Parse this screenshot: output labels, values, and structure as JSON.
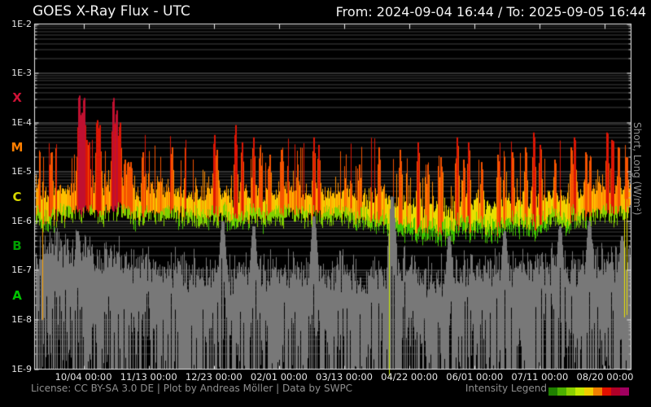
{
  "header": {
    "title": "GOES X-Ray Flux - UTC",
    "range": "From: 2024-09-04 16:44  /  To: 2025-09-05 16:44"
  },
  "footer": {
    "license": "License: CC BY-SA 3.0 DE | Plot by Andreas Möller | Data by SWPC",
    "legend_label": "Intensity Legend"
  },
  "right_axis_label": "Short, Long (W/m²)",
  "chart_data": {
    "type": "line",
    "title": "GOES X-Ray Flux - UTC",
    "x_range": {
      "from": "2024-09-04 16:44",
      "to": "2025-09-05 16:44",
      "days": 366
    },
    "ylog_range": [
      -9,
      -2
    ],
    "grid": "log-minor-horizontal",
    "y_ticks": [
      {
        "label": "1E-2",
        "log": -2
      },
      {
        "label": "1E-3",
        "log": -3
      },
      {
        "label": "1E-4",
        "log": -4
      },
      {
        "label": "1E-5",
        "log": -5
      },
      {
        "label": "1E-6",
        "log": -6
      },
      {
        "label": "1E-7",
        "log": -7
      },
      {
        "label": "1E-8",
        "log": -8
      },
      {
        "label": "1E-9",
        "log": -9
      }
    ],
    "class_bands": [
      {
        "label": "X",
        "color": "#cf1236",
        "log_mid": -3.5
      },
      {
        "label": "M",
        "color": "#ff7f00",
        "log_mid": -4.5
      },
      {
        "label": "C",
        "color": "#d8d800",
        "log_mid": -5.5
      },
      {
        "label": "B",
        "color": "#00a000",
        "log_mid": -6.5
      },
      {
        "label": "A",
        "color": "#00c400",
        "log_mid": -7.5
      }
    ],
    "x_ticks": [
      {
        "label": "10/04 00:00",
        "day": 30
      },
      {
        "label": "11/13 00:00",
        "day": 70
      },
      {
        "label": "12/23 00:00",
        "day": 110
      },
      {
        "label": "02/01 00:00",
        "day": 150
      },
      {
        "label": "03/13 00:00",
        "day": 190
      },
      {
        "label": "04/22 00:00",
        "day": 230
      },
      {
        "label": "06/01 00:00",
        "day": 270
      },
      {
        "label": "07/11 00:00",
        "day": 310
      },
      {
        "label": "08/20 00:00",
        "day": 350
      }
    ],
    "series": [
      {
        "name": "long",
        "color_mode": "intensity",
        "baseline_keyframes_log10": [
          [
            0,
            -5.75
          ],
          [
            8,
            -5.85
          ],
          [
            15,
            -5.7
          ],
          [
            25,
            -5.6
          ],
          [
            32,
            -5.55
          ],
          [
            40,
            -5.65
          ],
          [
            48,
            -5.55
          ],
          [
            56,
            -5.65
          ],
          [
            62,
            -5.8
          ],
          [
            70,
            -5.65
          ],
          [
            78,
            -5.75
          ],
          [
            85,
            -5.65
          ],
          [
            95,
            -5.75
          ],
          [
            105,
            -5.8
          ],
          [
            112,
            -5.7
          ],
          [
            120,
            -5.85
          ],
          [
            128,
            -5.75
          ],
          [
            135,
            -5.7
          ],
          [
            142,
            -5.8
          ],
          [
            150,
            -5.75
          ],
          [
            158,
            -5.65
          ],
          [
            165,
            -5.75
          ],
          [
            172,
            -5.7
          ],
          [
            180,
            -5.78
          ],
          [
            188,
            -5.7
          ],
          [
            196,
            -5.8
          ],
          [
            204,
            -5.88
          ],
          [
            212,
            -5.82
          ],
          [
            220,
            -5.95
          ],
          [
            228,
            -6.02
          ],
          [
            235,
            -6.1
          ],
          [
            242,
            -6.05
          ],
          [
            250,
            -6.12
          ],
          [
            258,
            -6.05
          ],
          [
            265,
            -5.95
          ],
          [
            272,
            -6.0
          ],
          [
            280,
            -6.05
          ],
          [
            288,
            -5.95
          ],
          [
            296,
            -5.9
          ],
          [
            304,
            -5.95
          ],
          [
            312,
            -5.85
          ],
          [
            318,
            -5.75
          ],
          [
            325,
            -5.85
          ],
          [
            332,
            -5.8
          ],
          [
            340,
            -5.7
          ],
          [
            348,
            -5.65
          ],
          [
            355,
            -5.72
          ],
          [
            360,
            -5.65
          ],
          [
            366,
            -5.6
          ]
        ],
        "flares_log10_peaks": [
          [
            10,
            -4.6
          ],
          [
            27,
            -3.45
          ],
          [
            28.5,
            -3.8
          ],
          [
            30,
            -3.5
          ],
          [
            31.5,
            -4.35
          ],
          [
            33,
            -4.4
          ],
          [
            38,
            -3.95
          ],
          [
            39.5,
            -4.05
          ],
          [
            48,
            -3.5
          ],
          [
            50,
            -3.75
          ],
          [
            52,
            -4.0
          ],
          [
            55,
            -4.75
          ],
          [
            57,
            -4.8
          ],
          [
            58.5,
            -4.8
          ],
          [
            66,
            -4.6
          ],
          [
            84,
            -4.5
          ],
          [
            110,
            -4.25
          ],
          [
            111.5,
            -4.55
          ],
          [
            123,
            -4.05
          ],
          [
            127,
            -4.4
          ],
          [
            134,
            -4.3
          ],
          [
            138,
            -4.5
          ],
          [
            144,
            -4.65
          ],
          [
            151,
            -4.55
          ],
          [
            161,
            -4.85
          ],
          [
            171,
            -4.3
          ],
          [
            174,
            -4.45
          ],
          [
            199,
            -4.85
          ],
          [
            211,
            -4.5
          ],
          [
            224,
            -4.55
          ],
          [
            235,
            -4.4
          ],
          [
            241,
            -4.85
          ],
          [
            249,
            -4.7
          ],
          [
            259,
            -4.3
          ],
          [
            263,
            -4.75
          ],
          [
            266,
            -4.4
          ],
          [
            274,
            -4.8
          ],
          [
            284,
            -4.65
          ],
          [
            293,
            -4.6
          ],
          [
            301,
            -4.5
          ],
          [
            306,
            -4.2
          ],
          [
            310,
            -4.45
          ],
          [
            319,
            -4.75
          ],
          [
            329,
            -4.5
          ],
          [
            331,
            -4.3
          ],
          [
            338,
            -4.6
          ],
          [
            351,
            -4.2
          ],
          [
            354,
            -4.35
          ],
          [
            358,
            -4.5
          ],
          [
            363,
            -4.7
          ]
        ]
      },
      {
        "name": "short",
        "color": "#787878",
        "envelope_keyframes_log10": [
          [
            0,
            -6.6
          ],
          [
            10,
            -6.5
          ],
          [
            20,
            -6.7
          ],
          [
            30,
            -6.55
          ],
          [
            40,
            -6.7
          ],
          [
            50,
            -6.6
          ],
          [
            60,
            -6.9
          ],
          [
            70,
            -6.8
          ],
          [
            80,
            -7.0
          ],
          [
            90,
            -6.9
          ],
          [
            100,
            -7.05
          ],
          [
            110,
            -6.95
          ],
          [
            120,
            -7.1
          ],
          [
            130,
            -7.0
          ],
          [
            140,
            -6.95
          ],
          [
            150,
            -7.05
          ],
          [
            160,
            -6.95
          ],
          [
            170,
            -7.0
          ],
          [
            180,
            -7.05
          ],
          [
            190,
            -7.0
          ],
          [
            200,
            -7.1
          ],
          [
            210,
            -7.0
          ],
          [
            220,
            -6.9
          ],
          [
            228,
            -6.75
          ],
          [
            235,
            -7.0
          ],
          [
            245,
            -7.1
          ],
          [
            255,
            -7.05
          ],
          [
            265,
            -7.0
          ],
          [
            275,
            -7.05
          ],
          [
            285,
            -6.95
          ],
          [
            295,
            -7.0
          ],
          [
            305,
            -6.9
          ],
          [
            315,
            -6.85
          ],
          [
            325,
            -6.95
          ],
          [
            335,
            -6.9
          ],
          [
            345,
            -6.8
          ],
          [
            355,
            -6.85
          ],
          [
            366,
            -6.8
          ]
        ],
        "envelope_peaks_log10": [
          [
            26,
            -6.2
          ],
          [
            115,
            -6.0
          ],
          [
            134,
            -6.1
          ],
          [
            171,
            -5.9
          ],
          [
            219,
            -5.5
          ],
          [
            254,
            -6.3
          ],
          [
            288,
            -6.2
          ],
          [
            322,
            -6.1
          ],
          [
            340,
            -6.0
          ],
          [
            360,
            -6.3
          ]
        ]
      }
    ],
    "artifact_lines": [
      {
        "day": 4.6,
        "top_log": -5.2,
        "bottom_log": -8.0,
        "color": "#ffa200"
      },
      {
        "day": 217.3,
        "top_log": -5.85,
        "bottom_log": -9.15,
        "color": "#c6e800"
      },
      {
        "day": 361.8,
        "top_log": -5.55,
        "bottom_log": -7.95,
        "color": "#e8e000"
      },
      {
        "day": 363.4,
        "top_log": -5.55,
        "bottom_log": -7.9,
        "color": "#e8e000"
      }
    ],
    "intensity_legend_colors": [
      "#1f8000",
      "#4cb000",
      "#8ad000",
      "#c4e800",
      "#f0ce00",
      "#f08000",
      "#e01000",
      "#b00028",
      "#a00060"
    ]
  }
}
